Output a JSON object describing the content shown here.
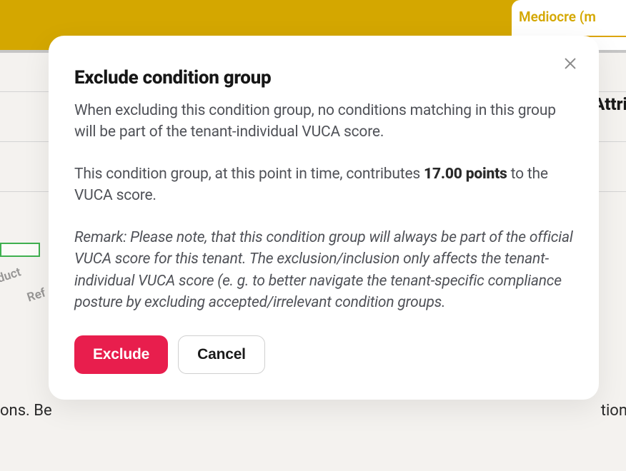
{
  "background": {
    "panel_right_text": "Mediocre (m",
    "ghost_label_1": "duct",
    "ghost_label_2": "Ref",
    "bottom_left": "ons. Be",
    "bottom_right": "tion",
    "right_attr": "Attri"
  },
  "modal": {
    "title": "Exclude condition group",
    "para1": "When excluding this condition group, no conditions matching in this group will be part of the tenant-individual VUCA score.",
    "para2_prefix": "This condition group, at this point in time, contributes ",
    "para2_points": "17.00 points",
    "para2_suffix": " to the VUCA score.",
    "remark": "Remark: Please note, that this condition group will always be part of the official VUCA score for this tenant. The exclusion/inclusion only affects the tenant-individual VUCA score (e. g. to better navigate the tenant-specific compliance posture by excluding accepted/irrelevant condition groups.",
    "actions": {
      "primary": "Exclude",
      "secondary": "Cancel"
    }
  }
}
